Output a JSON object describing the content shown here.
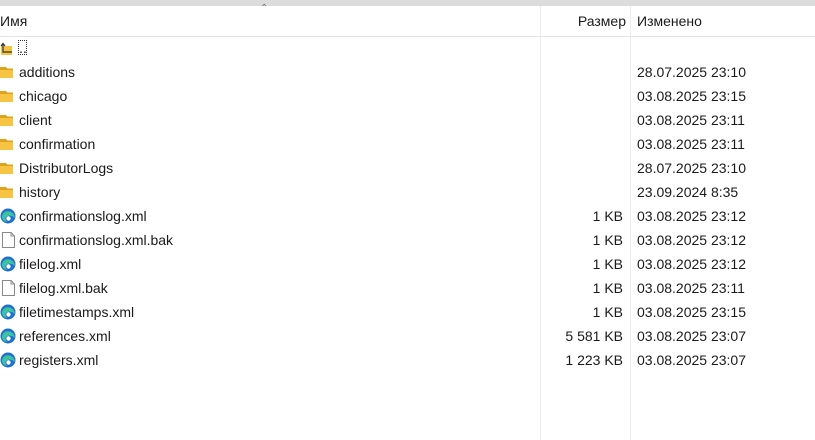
{
  "header": {
    "name_label": "Имя",
    "size_label": "Размер",
    "modified_label": "Изменено"
  },
  "up_dir": {
    "label": ".."
  },
  "rows": [
    {
      "name": "additions",
      "size": "",
      "modified": "28.07.2025 23:10",
      "icon": "folder-icon"
    },
    {
      "name": "chicago",
      "size": "",
      "modified": "03.08.2025 23:15",
      "icon": "folder-icon"
    },
    {
      "name": "client",
      "size": "",
      "modified": "03.08.2025 23:11",
      "icon": "folder-icon"
    },
    {
      "name": "confirmation",
      "size": "",
      "modified": "03.08.2025 23:11",
      "icon": "folder-icon"
    },
    {
      "name": "DistributorLogs",
      "size": "",
      "modified": "28.07.2025 23:10",
      "icon": "folder-icon"
    },
    {
      "name": "history",
      "size": "",
      "modified": "23.09.2024 8:35",
      "icon": "folder-icon"
    },
    {
      "name": "confirmationslog.xml",
      "size": "1 KB",
      "modified": "03.08.2025 23:12",
      "icon": "edge-icon"
    },
    {
      "name": "confirmationslog.xml.bak",
      "size": "1 KB",
      "modified": "03.08.2025 23:12",
      "icon": "file-icon"
    },
    {
      "name": "filelog.xml",
      "size": "1 KB",
      "modified": "03.08.2025 23:12",
      "icon": "edge-icon"
    },
    {
      "name": "filelog.xml.bak",
      "size": "1 KB",
      "modified": "03.08.2025 23:11",
      "icon": "file-icon"
    },
    {
      "name": "filetimestamps.xml",
      "size": "1 KB",
      "modified": "03.08.2025 23:15",
      "icon": "edge-icon"
    },
    {
      "name": "references.xml",
      "size": "5 581 KB",
      "modified": "03.08.2025 23:07",
      "icon": "edge-icon"
    },
    {
      "name": "registers.xml",
      "size": "1 223 KB",
      "modified": "03.08.2025 23:07",
      "icon": "edge-icon"
    }
  ],
  "colors": {
    "folder": "#f6c342",
    "folder_dark": "#e0a21c",
    "edge_blue": "#1f6fd1",
    "edge_green": "#3cc3a1"
  }
}
